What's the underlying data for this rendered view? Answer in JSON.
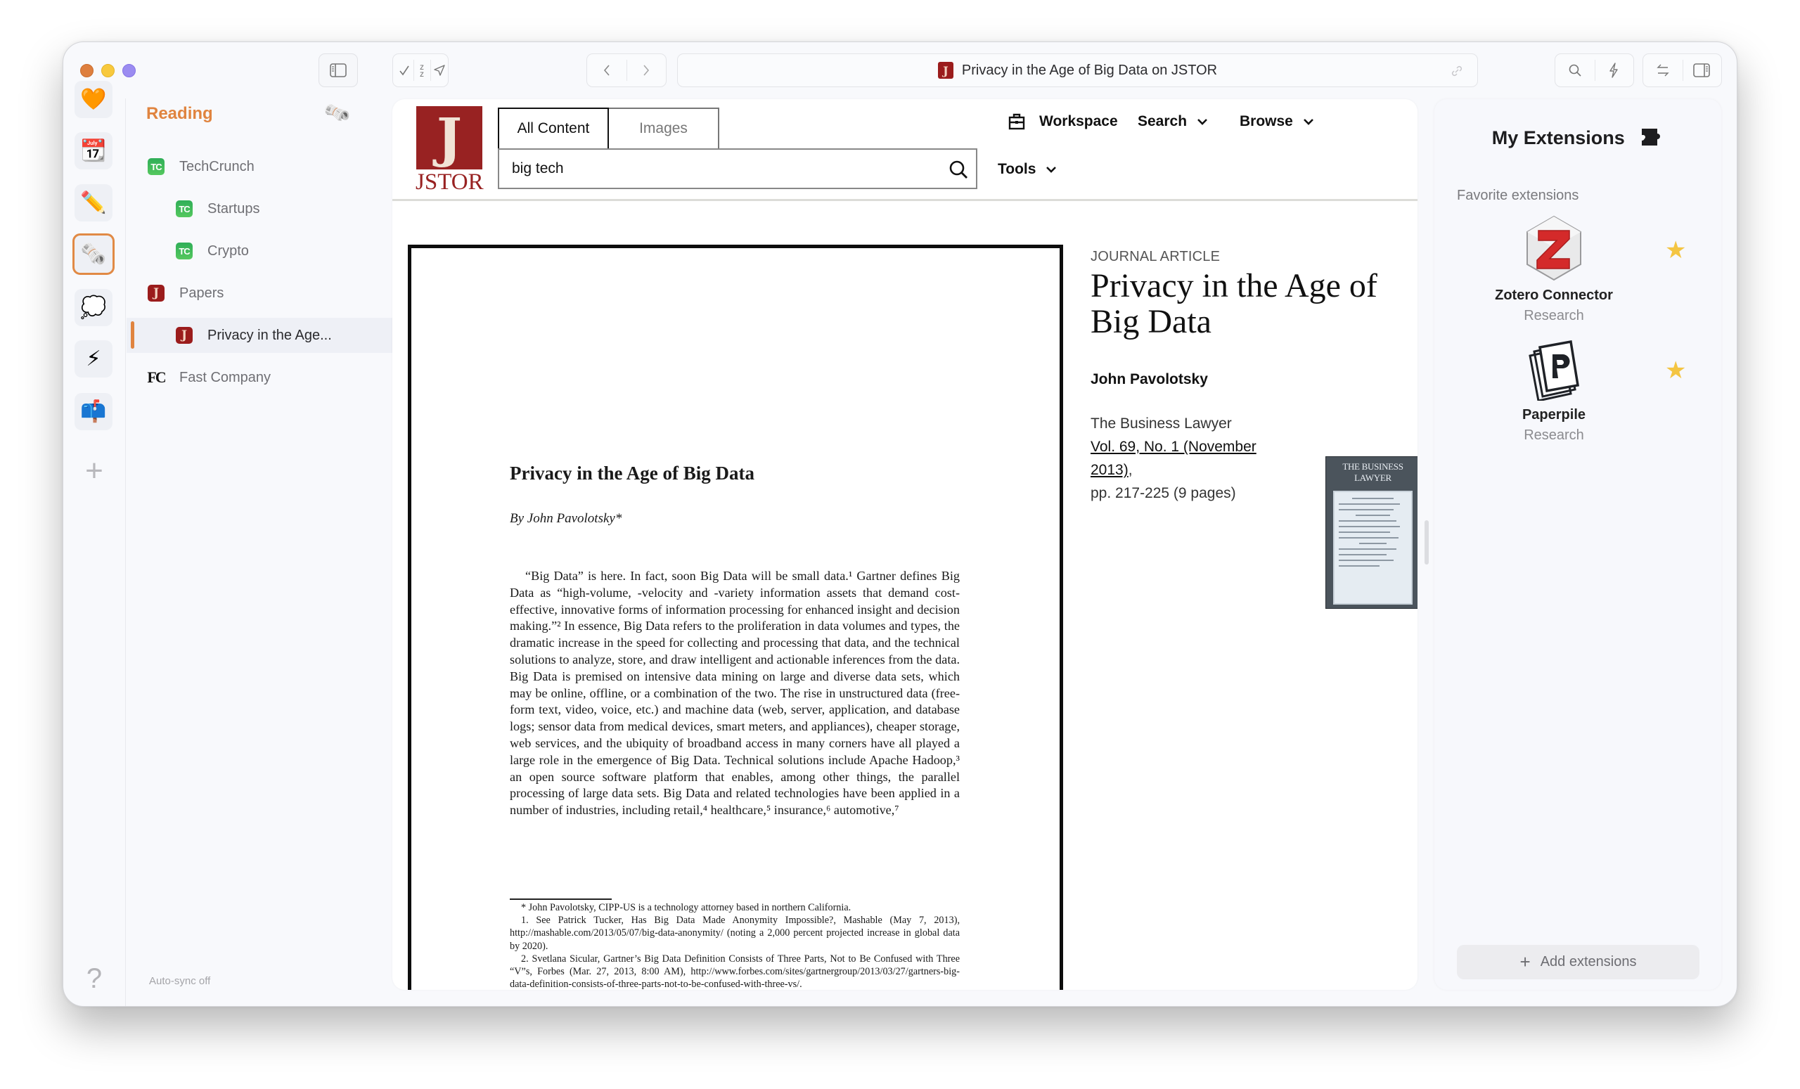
{
  "window": {
    "traffic_lights": [
      "close",
      "minimize",
      "zoom"
    ]
  },
  "rail": {
    "items": [
      {
        "name": "favorites",
        "emoji": "🧡"
      },
      {
        "name": "calendar",
        "emoji": "📆"
      },
      {
        "name": "pencil",
        "emoji": "✏️"
      },
      {
        "name": "reading",
        "emoji": "🗞️",
        "active": true
      },
      {
        "name": "speech-bubble",
        "emoji": "💭"
      },
      {
        "name": "lightning",
        "emoji": "⚡"
      },
      {
        "name": "mailbox",
        "emoji": "📫"
      }
    ],
    "add_label": "+",
    "help_label": "?"
  },
  "sidebar": {
    "space_title": "Reading",
    "space_icon": "🗞️",
    "items": [
      {
        "label": "TechCrunch",
        "favicon": "TC",
        "locked": true,
        "level": 0
      },
      {
        "label": "Startups",
        "favicon": "TC",
        "locked": false,
        "level": 1
      },
      {
        "label": "Crypto",
        "favicon": "TC",
        "locked": false,
        "level": 1
      },
      {
        "label": "Papers",
        "favicon": "J",
        "locked": true,
        "level": 0
      },
      {
        "label": "Privacy in the Age...",
        "favicon": "J",
        "locked": false,
        "level": 1,
        "selected": true
      },
      {
        "label": "Fast Company",
        "favicon": "FC",
        "locked": true,
        "level": 0
      }
    ],
    "footer_status": "Auto-sync off"
  },
  "toolbar": {
    "url_title": "Privacy in the Age of Big Data on JSTOR"
  },
  "jstor": {
    "wordmark": "JSTOR",
    "logo_letter": "J",
    "tabs": [
      "All Content",
      "Images"
    ],
    "search_value": "big tech",
    "nav": {
      "workspace": "Workspace",
      "search": "Search",
      "browse": "Browse",
      "tools": "Tools"
    }
  },
  "pdf": {
    "title": "Privacy in the Age of Big Data",
    "byline": "By John Pavolotsky*",
    "body": "“Big Data” is here. In fact, soon Big Data will be small data.¹ Gartner defines Big Data as “high-volume, -velocity and -variety information assets that demand cost-effective, innovative forms of information processing for enhanced insight and decision making.”² In essence, Big Data refers to the proliferation in data volumes and types, the dramatic increase in the speed for collecting and processing that data, and the technical solutions to analyze, store, and draw intelligent and actionable inferences from the data. Big Data is premised on intensive data mining on large and diverse data sets, which may be online, offline, or a combination of the two. The rise in unstructured data (free-form text, video, voice, etc.) and machine data (web, server, application, and database logs; sensor data from medical devices, smart meters, and appliances), cheaper storage, web services, and the ubiquity of broadband access in many corners have all played a large role in the emergence of Big Data. Technical solutions include Apache Hadoop,³ an open source software platform that enables, among other things, the parallel processing of large data sets. Big Data and related technologies have been applied in a number of industries, including retail,⁴ healthcare,⁵ insurance,⁶ automotive,⁷",
    "footnotes": [
      "* John Pavolotsky, CIPP-US is a technology attorney based in northern California.",
      "1. See Patrick Tucker, Has Big Data Made Anonymity Impossible?, Mashable (May 7, 2013), http://mashable.com/2013/05/07/big-data-anonymity/ (noting a 2,000 percent projected increase in global data by 2020).",
      "2. Svetlana Sicular, Gartner’s Big Data Definition Consists of Three Parts, Not to Be Confused with Three “V”s, Forbes (Mar. 27, 2013, 8:00 AM), http://www.forbes.com/sites/gartnergroup/2013/03/27/gartners-big-data-definition-consists-of-three-parts-not-to-be-confused-with-three-vs/."
    ]
  },
  "article": {
    "type": "JOURNAL ARTICLE",
    "title": "Privacy in the Age of Big Data",
    "author": "John Pavolotsky",
    "journal": "The Business Lawyer",
    "issue_link": "Vol. 69, No. 1 (November 2013)",
    "pages": "pp. 217-225 (9 pages)",
    "cover_title": "THE BUSINESS LAWYER"
  },
  "extensions": {
    "title": "My Extensions",
    "section_label": "Favorite extensions",
    "items": [
      {
        "name": "Zotero Connector",
        "category": "Research",
        "favorite": true
      },
      {
        "name": "Paperpile",
        "category": "Research",
        "favorite": true
      }
    ],
    "add_label": "Add extensions",
    "star_color": "#f4c542"
  },
  "colors": {
    "accent": "#e0843f",
    "jstor_red": "#982222"
  }
}
